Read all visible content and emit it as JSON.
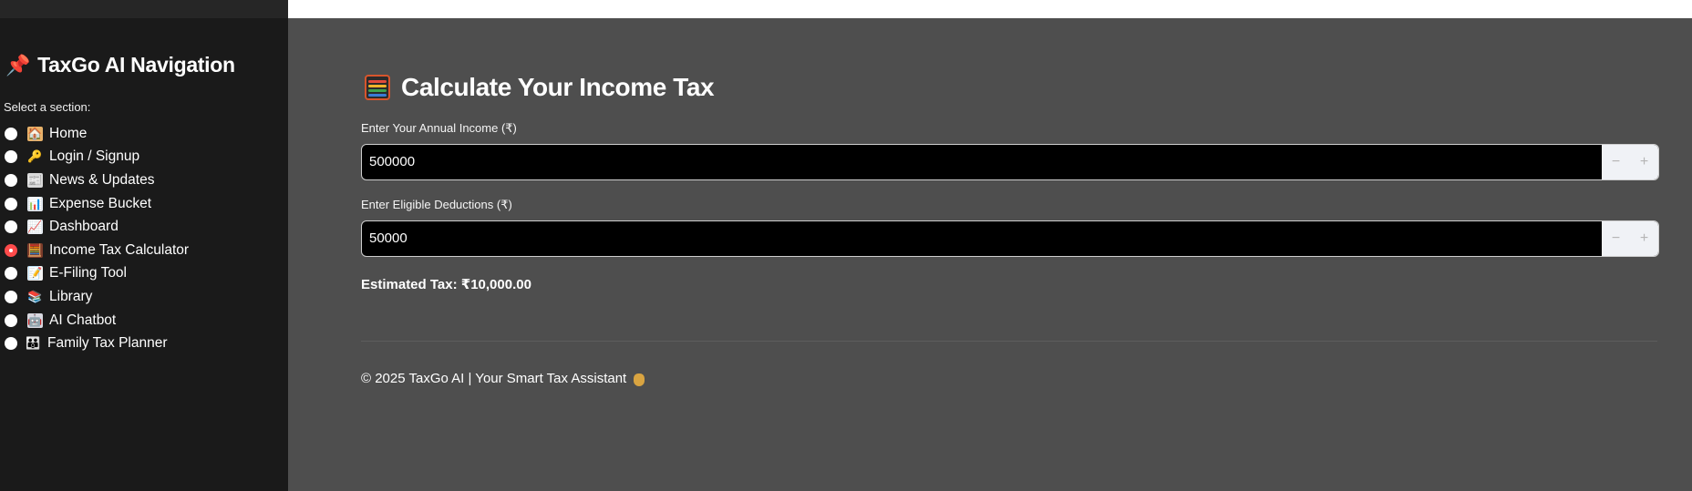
{
  "sidebar": {
    "title": "TaxGo AI Navigation",
    "title_icon": "pushpin-icon",
    "select_label": "Select a section:",
    "items": [
      {
        "label": "Home",
        "icon": "house-icon",
        "selected": false
      },
      {
        "label": "Login / Signup",
        "icon": "key-icon",
        "selected": false
      },
      {
        "label": "News & Updates",
        "icon": "newspaper-icon",
        "selected": false
      },
      {
        "label": "Expense Bucket",
        "icon": "bar-chart-icon",
        "selected": false
      },
      {
        "label": "Dashboard",
        "icon": "line-chart-icon",
        "selected": false
      },
      {
        "label": "Income Tax Calculator",
        "icon": "abacus-icon",
        "selected": true
      },
      {
        "label": "E-Filing Tool",
        "icon": "memo-icon",
        "selected": false
      },
      {
        "label": "Library",
        "icon": "books-icon",
        "selected": false
      },
      {
        "label": "AI Chatbot",
        "icon": "robot-icon",
        "selected": false
      },
      {
        "label": "Family Tax Planner",
        "icon": "family-icon",
        "selected": false
      }
    ]
  },
  "main": {
    "title": "Calculate Your Income Tax",
    "title_icon": "abacus-icon",
    "income": {
      "label": "Enter Your Annual Income (₹)",
      "value": "500000",
      "minus": "−",
      "plus": "+"
    },
    "deductions": {
      "label": "Enter Eligible Deductions (₹)",
      "value": "50000",
      "minus": "−",
      "plus": "+"
    },
    "result": "Estimated Tax: ₹10,000.00",
    "footer": "© 2025 TaxGo AI | Your Smart Tax Assistant"
  },
  "colors": {
    "sidebar_bg": "#1a1a1a",
    "main_bg": "#4e4e4e",
    "accent": "#ff4b4b",
    "input_bg": "#000000"
  }
}
